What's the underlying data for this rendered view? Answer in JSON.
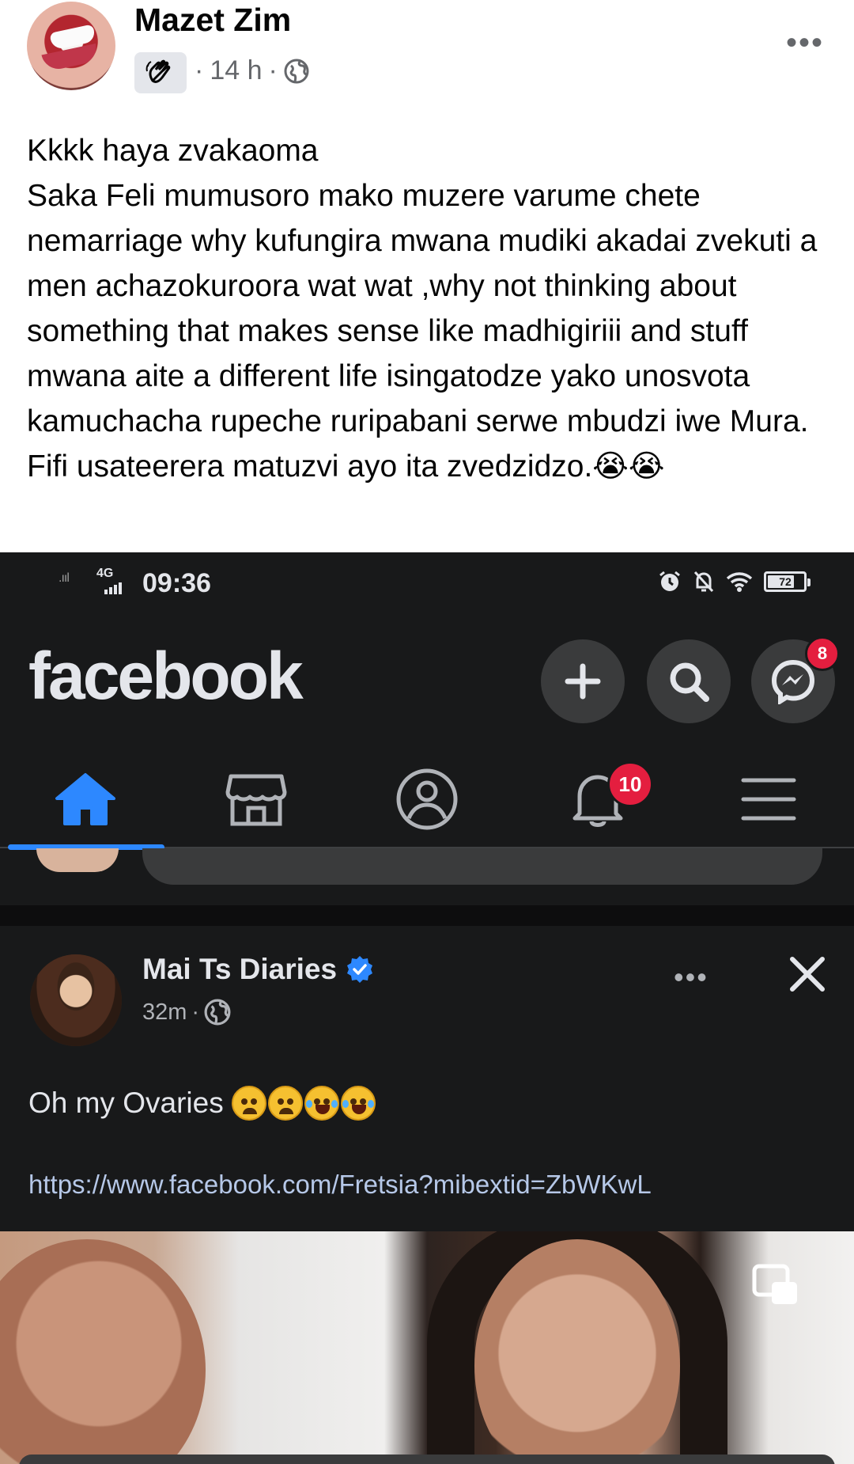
{
  "outer_post": {
    "author": "Mazet Zim",
    "time": "14 h",
    "separator": "·",
    "audience_icon": "globe-icon",
    "badge_icon": "waving-hand-icon",
    "more_label": "•••",
    "text": "Kkkk haya zvakaoma\nSaka Feli mumusoro mako muzere varume chete nemarriage why kufungira mwana mudiki akadai zvekuti a men achazokuroora wat wat ,why not thinking about something that makes sense like madhigiriii and stuff mwana aite a different life isingatodze yako unosvota kamuchacha rupeche ruripabani serwe mbudzi iwe Mura. Fifi usateerera matuzvi ayo ita zvedzidzo.😭😭"
  },
  "screenshot": {
    "status_bar": {
      "network": "4G",
      "time": "09:36",
      "battery": "72",
      "icons": [
        "alarm-icon",
        "mute-icon",
        "wifi-icon",
        "battery-icon"
      ]
    },
    "app_bar": {
      "logo": "facebook",
      "buttons": [
        "add-icon",
        "search-icon",
        "messenger-icon"
      ],
      "messenger_badge": "8"
    },
    "nav": {
      "items": [
        "home-icon",
        "marketplace-icon",
        "profile-icon",
        "notifications-icon",
        "menu-icon"
      ],
      "active": "home-icon",
      "notifications_badge": "10"
    },
    "post": {
      "author": "Mai Ts Diaries",
      "verified": true,
      "time": "32m",
      "separator": "·",
      "audience_icon": "globe-icon",
      "more_label": "•••",
      "text": "Oh my Ovaries",
      "emojis": [
        "crying-face",
        "crying-face",
        "laughing-face",
        "laughing-face"
      ],
      "link": "https://www.facebook.com/Fretsia?mibextid=ZbWKwL"
    }
  },
  "colors": {
    "dark_bg": "#18191a",
    "dark_button": "#3a3b3c",
    "accent_blue": "#2d88ff",
    "badge_red": "#e41e3f",
    "text_light": "#e4e6eb",
    "text_secondary": "#b0b3b8"
  }
}
